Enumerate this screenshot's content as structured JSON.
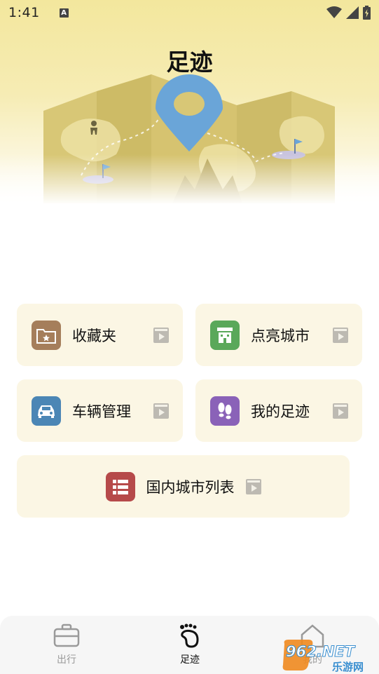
{
  "status_bar": {
    "time": "1:41",
    "notification_letter": "A"
  },
  "header": {
    "title": "足迹"
  },
  "menu": {
    "favorites_label": "收藏夹",
    "light_city_label": "点亮城市",
    "vehicle_label": "车辆管理",
    "my_footprint_label": "我的足迹",
    "city_list_label": "国内城市列表"
  },
  "tabs": [
    {
      "label": "出行"
    },
    {
      "label": "足迹"
    },
    {
      "label": "我的"
    }
  ],
  "watermark": {
    "brand": "962.NET",
    "subtitle": "乐游网"
  },
  "colors": {
    "card_bg": "#fbf6e4",
    "favorites_icon": "#a57e5b",
    "light_city_icon": "#5aa85a",
    "vehicle_icon": "#4b86b5",
    "footprint_icon": "#8a62b8",
    "city_list_icon": "#b64a4a",
    "pin": "#6aa5d8"
  }
}
